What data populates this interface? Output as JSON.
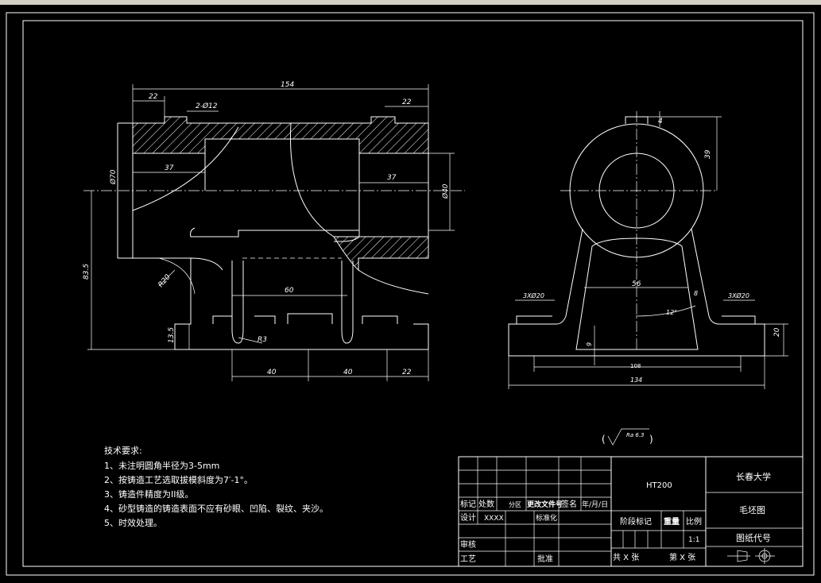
{
  "drawing": {
    "front_view": {
      "dimensions": [
        "154",
        "22",
        "2-Ø12",
        "22",
        "37",
        "37",
        "Ø70",
        "Ø40",
        "83.5",
        "R20",
        "60",
        "R3",
        "13.5",
        "40",
        "40",
        "22"
      ]
    },
    "side_view": {
      "dimensions": [
        "4",
        "39",
        "56",
        "3XØ20",
        "3XØ20",
        "8",
        "12°",
        "9",
        "20",
        "108",
        "134"
      ]
    },
    "surface_finish": "Ra 6.3",
    "technical_requirements": {
      "title": "技术要求:",
      "items": [
        "1、未注明圆角半径为3-5mm",
        "2、按铸造工艺选取拔模斜度为7′-1°。",
        "3、铸造件精度为II级。",
        "4、砂型铸造的铸造表面不应有砂眼、凹陷、裂纹、夹沙。",
        "5、时效处理。"
      ]
    },
    "title_block": {
      "material": "HT200",
      "school": "长春大学",
      "drawing_name": "毛坯图",
      "drawing_code": "图纸代号",
      "mark": "标记",
      "count": "处数",
      "zone": "分区",
      "change_doc": "更改文件号",
      "signature": "签名",
      "date": "年/月/日",
      "design": "设计",
      "designer": "XXXX",
      "standardize": "标准化",
      "stage_mark": "阶段标记",
      "weight": "重量",
      "scale_label": "比例",
      "scale_value": "1:1",
      "review": "审核",
      "process": "工艺",
      "approve": "批准",
      "sheets_total": "共 X 张",
      "sheet_no": "第 X 张"
    }
  }
}
